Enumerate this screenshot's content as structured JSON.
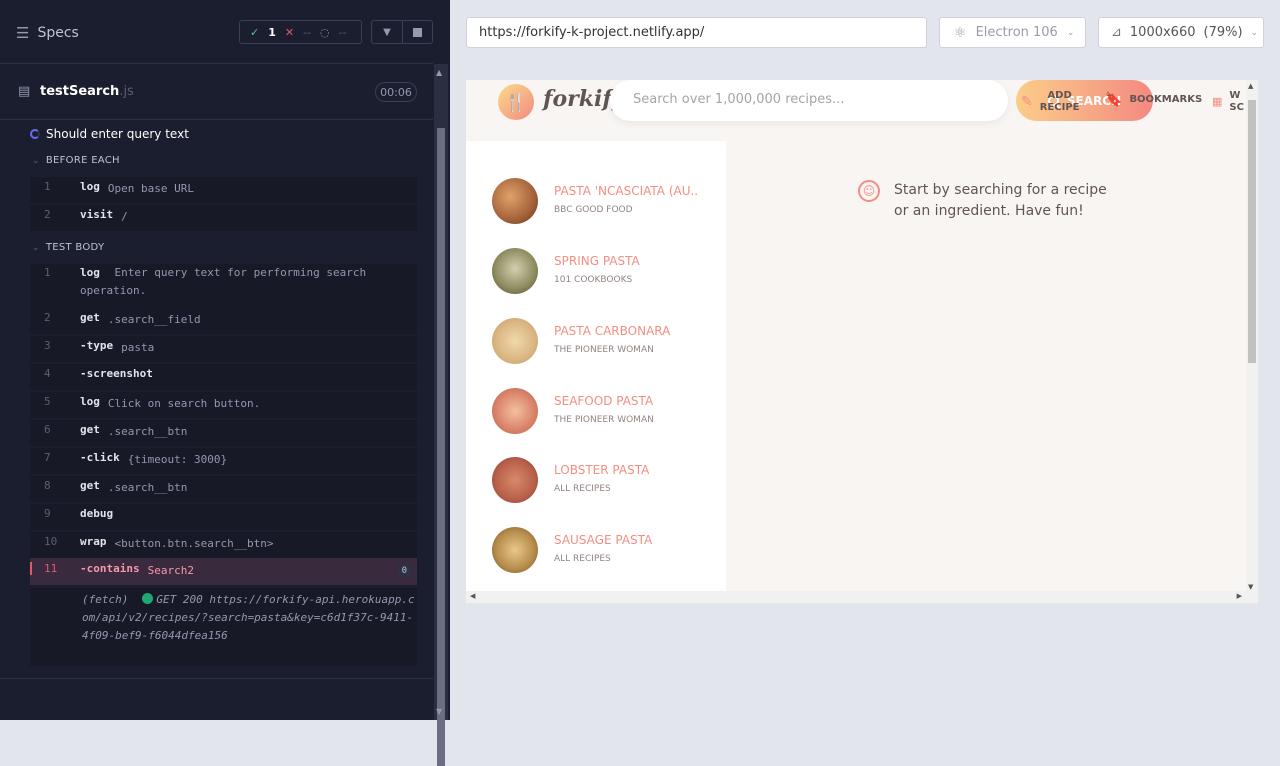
{
  "reporter": {
    "specs_label": "Specs",
    "stats": {
      "passed": "1",
      "failed": "--",
      "pending": "--"
    },
    "file": {
      "name": "testSearch",
      "ext": ".js",
      "duration": "00:06"
    },
    "test_title": "Should enter query text",
    "before_each": {
      "label": "BEFORE EACH",
      "commands": [
        {
          "num": "1",
          "name": "log",
          "msg": "Open base URL"
        },
        {
          "num": "2",
          "name": "visit",
          "msg": "/"
        }
      ]
    },
    "test_body": {
      "label": "TEST BODY",
      "commands": [
        {
          "num": "1",
          "name": "log",
          "msg": "Enter query text for performing search operation."
        },
        {
          "num": "2",
          "name": "get",
          "msg": ".search__field"
        },
        {
          "num": "3",
          "name": "-type",
          "msg": "pasta"
        },
        {
          "num": "4",
          "name": "-screenshot",
          "msg": ""
        },
        {
          "num": "5",
          "name": "log",
          "msg": "Click on search button."
        },
        {
          "num": "6",
          "name": "get",
          "msg": ".search__btn"
        },
        {
          "num": "7",
          "name": "-click",
          "msg": "{timeout: 3000}"
        },
        {
          "num": "8",
          "name": "get",
          "msg": ".search__btn"
        },
        {
          "num": "9",
          "name": "debug",
          "msg": ""
        },
        {
          "num": "10",
          "name": "wrap",
          "msg": "<button.btn.search__btn>"
        },
        {
          "num": "11",
          "name": "-contains",
          "msg": "Search2",
          "badge": "0"
        }
      ]
    },
    "fetch": {
      "label": "(fetch)",
      "text": "GET 200 https://forkify-api.herokuapp.com/api/v2/recipes/?search=pasta&key=c6d1f37c-9411-4f09-bef9-f6044dfea156"
    }
  },
  "runner": {
    "url": "https://forkify-k-project.netlify.app/",
    "browser": "Electron 106",
    "viewport": "1000x660",
    "zoom": "(79%)"
  },
  "app": {
    "logo_text": "forkify",
    "search_placeholder": "Search over 1,000,000 recipes...",
    "search_button": "SEARCH",
    "nav": {
      "add_recipe_1": "ADD",
      "add_recipe_2": "RECIPE",
      "bookmarks": "BOOKMARKS",
      "other_1": "W",
      "other_2": "SC"
    },
    "results": [
      {
        "title": "PASTA 'NCASCIATA (AU...",
        "publisher": "BBC GOOD FOOD",
        "color": "#a4623a"
      },
      {
        "title": "SPRING PASTA",
        "publisher": "101 COOKBOOKS",
        "color": "#8c8a5e"
      },
      {
        "title": "PASTA CARBONARA",
        "publisher": "THE PIONEER WOMAN",
        "color": "#d9b583"
      },
      {
        "title": "SEAFOOD PASTA",
        "publisher": "THE PIONEER WOMAN",
        "color": "#d9826a"
      },
      {
        "title": "LOBSTER PASTA",
        "publisher": "ALL RECIPES",
        "color": "#b8604a"
      },
      {
        "title": "SAUSAGE PASTA",
        "publisher": "ALL RECIPES",
        "color": "#b58b4a"
      }
    ],
    "message": "Start by searching for a recipe or an ingredient. Have fun!"
  },
  "colors": {
    "accent": "#f38e82",
    "reporter_bg": "#1b1e2e",
    "error": "#e45770",
    "pass": "#59c597"
  }
}
